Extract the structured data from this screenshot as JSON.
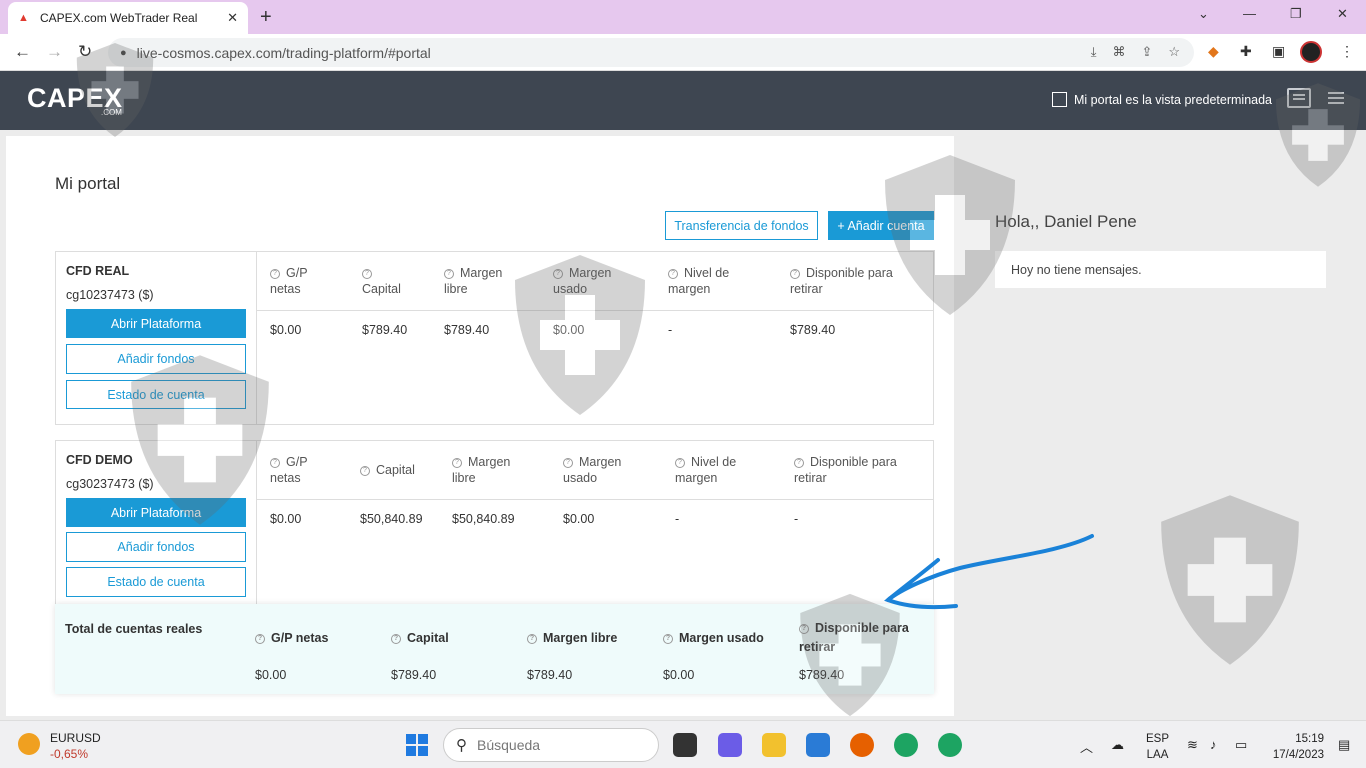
{
  "browser": {
    "tab_title": "CAPEX.com WebTrader Real",
    "tab_close": "✕",
    "new_tab": "+",
    "url": "live-cosmos.capex.com/trading-platform/#portal",
    "win_minimize": "⌄",
    "win_min2": "—",
    "win_restore": "❐",
    "win_close": "✕",
    "back": "←",
    "forward": "→",
    "reload": "↻",
    "lock": "🔒"
  },
  "header": {
    "logo": "CAPEX",
    "logo_sub": ".COM",
    "default_view_label": "Mi portal es la vista predeterminada"
  },
  "portal": {
    "title": "Mi portal",
    "transfer_button": "Transferencia de fondos",
    "add_account_button": "+ Añadir cuenta",
    "accounts": [
      {
        "name": "CFD REAL",
        "id": "cg10237473 ($)",
        "open_platform": "Abrir Plataforma",
        "add_funds": "Añadir fondos",
        "statement": "Estado de cuenta",
        "headers": [
          "G/P netas",
          "Capital",
          "Margen libre",
          "Margen usado",
          "Nivel de margen",
          "Disponible para retirar"
        ],
        "values": [
          "$0.00",
          "$789.40",
          "$789.40",
          "$0.00",
          "-",
          "$789.40"
        ]
      },
      {
        "name": "CFD DEMO",
        "id": "cg30237473 ($)",
        "open_platform": "Abrir Plataforma",
        "add_funds": "Añadir fondos",
        "statement": "Estado de cuenta",
        "headers": [
          "G/P netas",
          "Capital",
          "Margen libre",
          "Margen usado",
          "Nivel de margen",
          "Disponible para retirar"
        ],
        "values": [
          "$0.00",
          "$50,840.89",
          "$50,840.89",
          "$0.00",
          "-",
          "-"
        ]
      }
    ],
    "totals": {
      "title": "Total de cuentas reales",
      "headers": [
        "G/P netas",
        "Capital",
        "Margen libre",
        "Margen usado",
        "Disponible para retirar"
      ],
      "values": [
        "$0.00",
        "$789.40",
        "$789.40",
        "$0.00",
        "$789.40"
      ]
    }
  },
  "sidebar": {
    "greeting": "Hola,, Daniel Pene",
    "messages": "Hoy no tiene mensajes."
  },
  "taskbar": {
    "ticker_name": "EURUSD",
    "ticker_change": "-0,65%",
    "search_placeholder": "Búsqueda",
    "lang_1": "ESP",
    "lang_2": "LAA",
    "time": "15:19",
    "date": "17/4/2023"
  }
}
